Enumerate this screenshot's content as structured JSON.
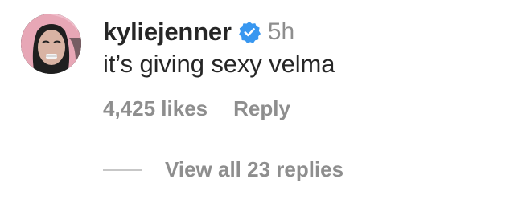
{
  "comment": {
    "username": "kyliejenner",
    "verified": true,
    "timestamp": "5h",
    "text": "it’s giving sexy velma",
    "likes": "4,425 likes",
    "reply_label": "Reply",
    "view_replies_label": "View all 23 replies"
  },
  "colors": {
    "primary_text": "#262626",
    "secondary_text": "#8e8e8e",
    "verified_badge": "#3897f0",
    "divider": "#c7c7c7"
  },
  "icons": {
    "verified": "verified-badge-icon"
  }
}
